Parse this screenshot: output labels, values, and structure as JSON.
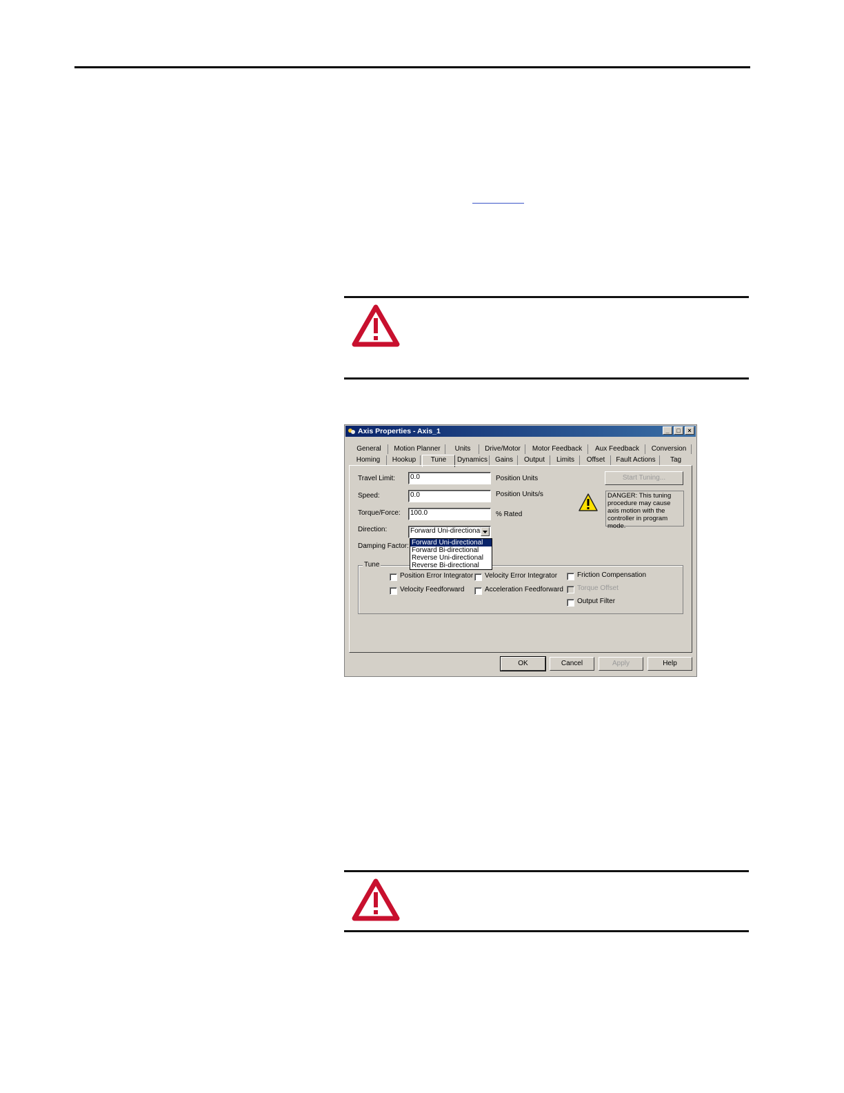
{
  "dialog": {
    "title": "Axis Properties - Axis_1",
    "window_buttons": {
      "minimize": "_",
      "maximize": "□",
      "close": "×"
    },
    "tabs_row1": [
      "General",
      "Motion Planner",
      "Units",
      "Drive/Motor",
      "Motor Feedback",
      "Aux Feedback",
      "Conversion"
    ],
    "tabs_row2": [
      "Homing",
      "Hookup",
      "Tune",
      "Dynamics",
      "Gains",
      "Output",
      "Limits",
      "Offset",
      "Fault Actions",
      "Tag"
    ],
    "active_tab": "Tune",
    "fields": {
      "travel_limit": {
        "label": "Travel Limit:",
        "value": "0.0",
        "units": "Position Units"
      },
      "speed": {
        "label": "Speed:",
        "value": "0.0",
        "units": "Position Units/s"
      },
      "torque_force": {
        "label": "Torque/Force:",
        "value": "100.0",
        "units": "% Rated"
      },
      "direction": {
        "label": "Direction:",
        "value": "Forward Uni-directional",
        "options": [
          "Forward Uni-directional",
          "Forward Bi-directional",
          "Reverse Uni-directional",
          "Reverse Bi-directional"
        ]
      },
      "damping_factor": {
        "label": "Damping Factor:"
      }
    },
    "start_tuning_label": "Start Tuning...",
    "danger_text": "DANGER: This tuning procedure may cause axis motion with the controller in program mode.",
    "tune_group": {
      "label": "Tune",
      "checkboxes": [
        {
          "label": "Position Error Integrator",
          "checked": false,
          "enabled": true
        },
        {
          "label": "Velocity Feedforward",
          "checked": false,
          "enabled": true
        },
        {
          "label": "Velocity Error Integrator",
          "checked": false,
          "enabled": true
        },
        {
          "label": "Acceleration Feedforward",
          "checked": false,
          "enabled": true
        },
        {
          "label": "Friction Compensation",
          "checked": false,
          "enabled": true
        },
        {
          "label": "Torque Offset",
          "checked": false,
          "enabled": false
        },
        {
          "label": "Output Filter",
          "checked": false,
          "enabled": true
        }
      ]
    },
    "buttons": {
      "ok": "OK",
      "cancel": "Cancel",
      "apply": "Apply",
      "help": "Help"
    }
  },
  "colors": {
    "warning_red": "#c8102e",
    "titlebar": "#0a246a",
    "dialog_face": "#d4d0c8"
  },
  "icons": [
    "warning-triangle-icon",
    "caution-icon",
    "app-icon",
    "chevron-down-icon"
  ]
}
